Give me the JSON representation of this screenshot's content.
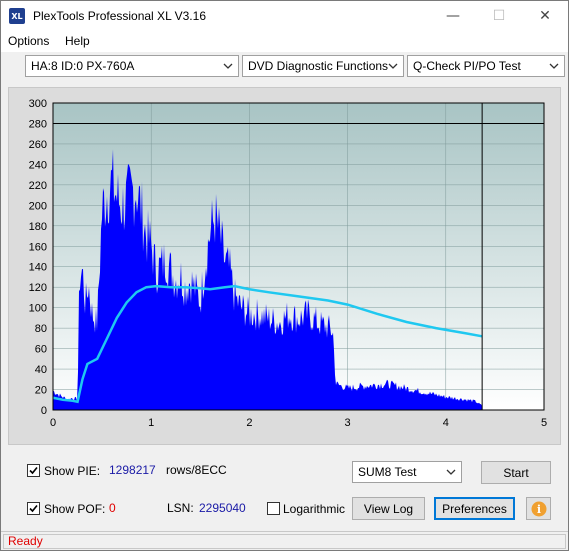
{
  "window": {
    "title": "PlexTools Professional XL V3.16",
    "icon_text": "XL",
    "controls": {
      "minimize": "—",
      "maximize": "☐",
      "close": "✕"
    }
  },
  "menu": {
    "options_label": "Options",
    "help_label": "Help"
  },
  "toolbar": {
    "drive_select": "HA:8 ID:0  PX-760A",
    "function_select": "DVD Diagnostic Functions",
    "test_select": "Q-Check PI/PO Test"
  },
  "bottom": {
    "show_pie_label": "Show PIE:",
    "pie_value": "1298217",
    "rows_label": "rows/8ECC",
    "show_pof_label": "Show POF:",
    "pof_value": "0",
    "lsn_label": "LSN:",
    "lsn_value": "2295040",
    "logarithmic_label": "Logarithmic",
    "test_mode_select": "SUM8 Test",
    "start_button": "Start",
    "view_log_button": "View Log",
    "preferences_button": "Preferences",
    "info_icon": "i",
    "show_pie_checked": true,
    "show_pof_checked": true,
    "logarithmic_checked": false
  },
  "status": {
    "text": "Ready"
  },
  "colors": {
    "bar_fill": "#0000ff",
    "speed_line": "#1fc8f0",
    "plot_bg": "#a8c4c4",
    "plot_bg_light": "#ffffff",
    "status_red": "#e00000"
  },
  "chart_data": {
    "type": "bar",
    "x_ticks": [
      "0",
      "1",
      "2",
      "3",
      "4",
      "5"
    ],
    "y_ticks": [
      "0",
      "20",
      "40",
      "60",
      "80",
      "100",
      "120",
      "140",
      "160",
      "180",
      "200",
      "220",
      "240",
      "260",
      "280",
      "300"
    ],
    "xlim": [
      0,
      5
    ],
    "ylim": [
      0,
      300
    ],
    "grid": true,
    "end_marker_x": 4.37,
    "limit_line_y": 280,
    "pie_envelope": [
      [
        0.0,
        22
      ],
      [
        0.05,
        18
      ],
      [
        0.1,
        15
      ],
      [
        0.15,
        12
      ],
      [
        0.2,
        14
      ],
      [
        0.25,
        12
      ],
      [
        0.27,
        155
      ],
      [
        0.3,
        160
      ],
      [
        0.33,
        120
      ],
      [
        0.36,
        145
      ],
      [
        0.4,
        110
      ],
      [
        0.45,
        100
      ],
      [
        0.5,
        230
      ],
      [
        0.55,
        250
      ],
      [
        0.6,
        262
      ],
      [
        0.65,
        245
      ],
      [
        0.7,
        235
      ],
      [
        0.75,
        240
      ],
      [
        0.8,
        250
      ],
      [
        0.85,
        255
      ],
      [
        0.9,
        230
      ],
      [
        0.95,
        200
      ],
      [
        1.0,
        190
      ],
      [
        1.05,
        160
      ],
      [
        1.1,
        165
      ],
      [
        1.15,
        175
      ],
      [
        1.2,
        160
      ],
      [
        1.25,
        150
      ],
      [
        1.3,
        155
      ],
      [
        1.35,
        140
      ],
      [
        1.4,
        150
      ],
      [
        1.45,
        138
      ],
      [
        1.5,
        125
      ],
      [
        1.55,
        170
      ],
      [
        1.6,
        205
      ],
      [
        1.65,
        222
      ],
      [
        1.7,
        200
      ],
      [
        1.75,
        170
      ],
      [
        1.8,
        160
      ],
      [
        1.85,
        130
      ],
      [
        1.9,
        120
      ],
      [
        1.95,
        115
      ],
      [
        2.0,
        110
      ],
      [
        2.1,
        110
      ],
      [
        2.2,
        105
      ],
      [
        2.3,
        100
      ],
      [
        2.4,
        110
      ],
      [
        2.5,
        105
      ],
      [
        2.6,
        110
      ],
      [
        2.7,
        100
      ],
      [
        2.8,
        95
      ],
      [
        2.85,
        90
      ],
      [
        2.88,
        30
      ],
      [
        3.0,
        25
      ],
      [
        3.2,
        28
      ],
      [
        3.4,
        30
      ],
      [
        3.6,
        25
      ],
      [
        3.8,
        20
      ],
      [
        4.0,
        15
      ],
      [
        4.2,
        12
      ],
      [
        4.3,
        10
      ],
      [
        4.37,
        5
      ]
    ],
    "speed_curve": [
      [
        0.0,
        12
      ],
      [
        0.1,
        10
      ],
      [
        0.2,
        9
      ],
      [
        0.25,
        8
      ],
      [
        0.3,
        30
      ],
      [
        0.35,
        45
      ],
      [
        0.45,
        50
      ],
      [
        0.55,
        70
      ],
      [
        0.65,
        90
      ],
      [
        0.75,
        105
      ],
      [
        0.85,
        115
      ],
      [
        0.95,
        120
      ],
      [
        1.05,
        121
      ],
      [
        1.2,
        120
      ],
      [
        1.35,
        120
      ],
      [
        1.5,
        119
      ],
      [
        1.6,
        118
      ],
      [
        1.75,
        120
      ],
      [
        1.85,
        121
      ],
      [
        2.0,
        118
      ],
      [
        2.2,
        115
      ],
      [
        2.5,
        111
      ],
      [
        2.8,
        107
      ],
      [
        3.0,
        103
      ],
      [
        3.3,
        94
      ],
      [
        3.6,
        86
      ],
      [
        3.9,
        80
      ],
      [
        4.2,
        75
      ],
      [
        4.37,
        72
      ]
    ]
  }
}
